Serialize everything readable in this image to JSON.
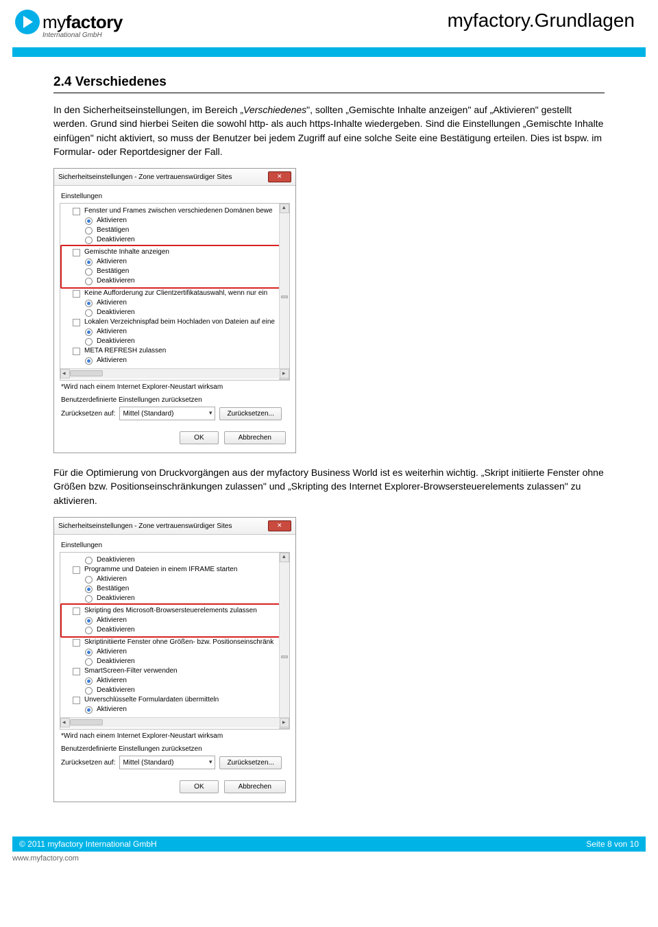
{
  "header": {
    "brand_my": "my",
    "brand_factory": "factory",
    "brand_sub": "International GmbH",
    "title": "myfactory.Grundlagen"
  },
  "section": {
    "num_title": "2.4  Verschiedenes",
    "para1_a": "In den Sicherheitseinstellungen, im Bereich „",
    "para1_ital": "Verschiedenes",
    "para1_b": "\", sollten „Gemischte Inhalte anzeigen\" auf „Aktivieren\" gestellt werden. Grund sind hierbei Seiten die  sowohl http- als auch https-Inhalte wiedergeben. Sind die Einstellungen „Gemischte Inhalte einfügen\" nicht aktiviert, so muss der Benutzer bei jedem Zugriff auf eine solche Seite eine Bestätigung erteilen. Dies ist bspw. im Formular- oder Reportdesigner der Fall.",
    "para2": "Für die Optimierung von Druckvorgängen aus der myfactory Business World ist es weiterhin wichtig. „Skript initiierte Fenster ohne Größen bzw. Positionseinschränkungen zulassen\" und „Skripting des Internet Explorer-Browsersteuerelements zulassen\" zu aktivieren."
  },
  "dialog1": {
    "title": "Sicherheitseinstellungen - Zone vertrauenswürdiger Sites",
    "group": "Einstellungen",
    "hint": "*Wird nach einem Internet Explorer-Neustart wirksam",
    "reset_group": "Benutzerdefinierte Einstellungen zurücksetzen",
    "reset_label": "Zurücksetzen auf:",
    "combo": "Mittel (Standard)",
    "reset_btn": "Zurücksetzen...",
    "ok": "OK",
    "cancel": "Abbrechen",
    "items": {
      "i0": "Fenster und Frames zwischen verschiedenen Domänen bewe",
      "r_akt": "Aktivieren",
      "r_best": "Bestätigen",
      "r_deakt": "Deaktivieren",
      "i1": "Gemischte Inhalte anzeigen",
      "i2": "Keine Aufforderung zur Clientzertifikatauswahl, wenn nur ein",
      "i3": "Lokalen Verzeichnispfad beim Hochladen von Dateien auf eine",
      "i4": "META REFRESH zulassen"
    }
  },
  "dialog2": {
    "title": "Sicherheitseinstellungen - Zone vertrauenswürdiger Sites",
    "group": "Einstellungen",
    "hint": "*Wird nach einem Internet Explorer-Neustart wirksam",
    "reset_group": "Benutzerdefinierte Einstellungen zurücksetzen",
    "reset_label": "Zurücksetzen auf:",
    "combo": "Mittel (Standard)",
    "reset_btn": "Zurücksetzen...",
    "ok": "OK",
    "cancel": "Abbrechen",
    "items": {
      "r_akt": "Aktivieren",
      "r_best": "Bestätigen",
      "r_deakt": "Deaktivieren",
      "i0": "Programme und Dateien in einem IFRAME starten",
      "i1": "Skripting des Microsoft-Browsersteuerelements zulassen",
      "i2": "Skriptinitiierte Fenster ohne Größen- bzw. Positionseinschränk",
      "i3": "SmartScreen-Filter verwenden",
      "i4": "Unverschlüsselte Formulardaten übermitteln"
    }
  },
  "footer": {
    "copyright": "© 2011 myfactory International GmbH",
    "page": "Seite 8 von 10",
    "url": "www.myfactory.com"
  }
}
